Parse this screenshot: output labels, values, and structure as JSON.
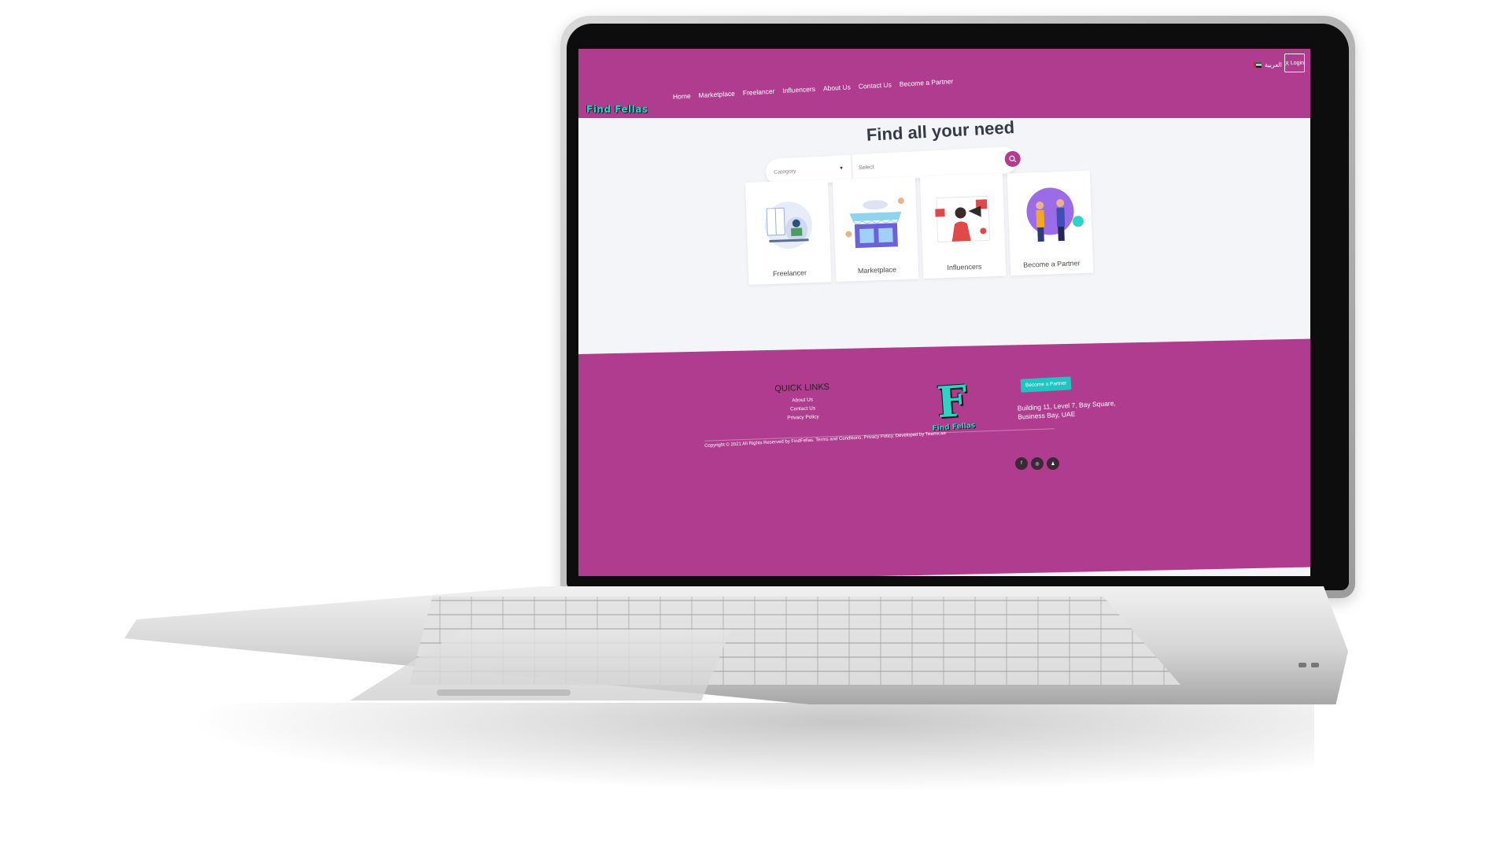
{
  "header": {
    "logo": "Find Fellas",
    "nav": [
      "Home",
      "Marketplace",
      "Freelancer",
      "Influencers",
      "About Us",
      "Contact Us",
      "Become a Partner"
    ],
    "language": "العربية",
    "login": "Login"
  },
  "hero": {
    "title": "Find all your need",
    "category_placeholder": "Category",
    "select_placeholder": "Select"
  },
  "cards": [
    {
      "label": "Freelancer",
      "icon": "freelancer-illustration"
    },
    {
      "label": "Marketplace",
      "icon": "marketplace-illustration"
    },
    {
      "label": "Influencers",
      "icon": "influencers-illustration"
    },
    {
      "label": "Become a Partner",
      "icon": "partner-illustration"
    }
  ],
  "footer": {
    "quick_links_title": "QUICK LINKS",
    "links": [
      "About Us",
      "Contact Us",
      "Privacy Policy"
    ],
    "logo_letter": "F",
    "logo_name": "Find Fellas",
    "partner_button": "Become a Partner",
    "address": "Building 11, Level 7, Bay Square, Business Bay, UAE",
    "copyright": "Copyright © 2021 All Rights Reserved by FindFellas. Terms and Conditions. Privacy Policy. Developed by Teamx.ae",
    "socials": [
      "f",
      "◎",
      "♟"
    ]
  },
  "colors": {
    "brand": "#b03c8f",
    "accent": "#1fc5c1",
    "background": "#f4f5f9"
  }
}
